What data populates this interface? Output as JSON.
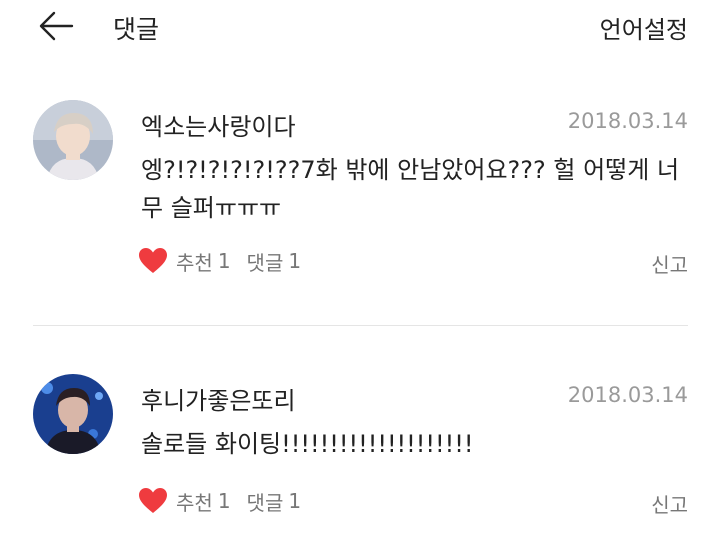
{
  "header": {
    "back_icon": "arrow-left-icon",
    "title": "댓글",
    "language_setting": "언어설정"
  },
  "colors": {
    "heart": "#ef3b3f",
    "muted_text": "#777777",
    "date_text": "#9a9a9a",
    "divider": "#e5e5e5"
  },
  "comments": [
    {
      "username": "엑소는사랑이다",
      "date": "2018.03.14",
      "text": "엥?!?!?!?!?!??7화 밖에 안남았어요??? 헐 어떻게 너무 슬퍼ㅠㅠㅠ",
      "like_label": "추천",
      "like_count": "1",
      "reply_label": "댓글",
      "reply_count": "1",
      "report_label": "신고"
    },
    {
      "username": "후니가좋은또리",
      "date": "2018.03.14",
      "text": "솔로들 화이팅!!!!!!!!!!!!!!!!!!!!",
      "like_label": "추천",
      "like_count": "1",
      "reply_label": "댓글",
      "reply_count": "1",
      "report_label": "신고"
    }
  ]
}
